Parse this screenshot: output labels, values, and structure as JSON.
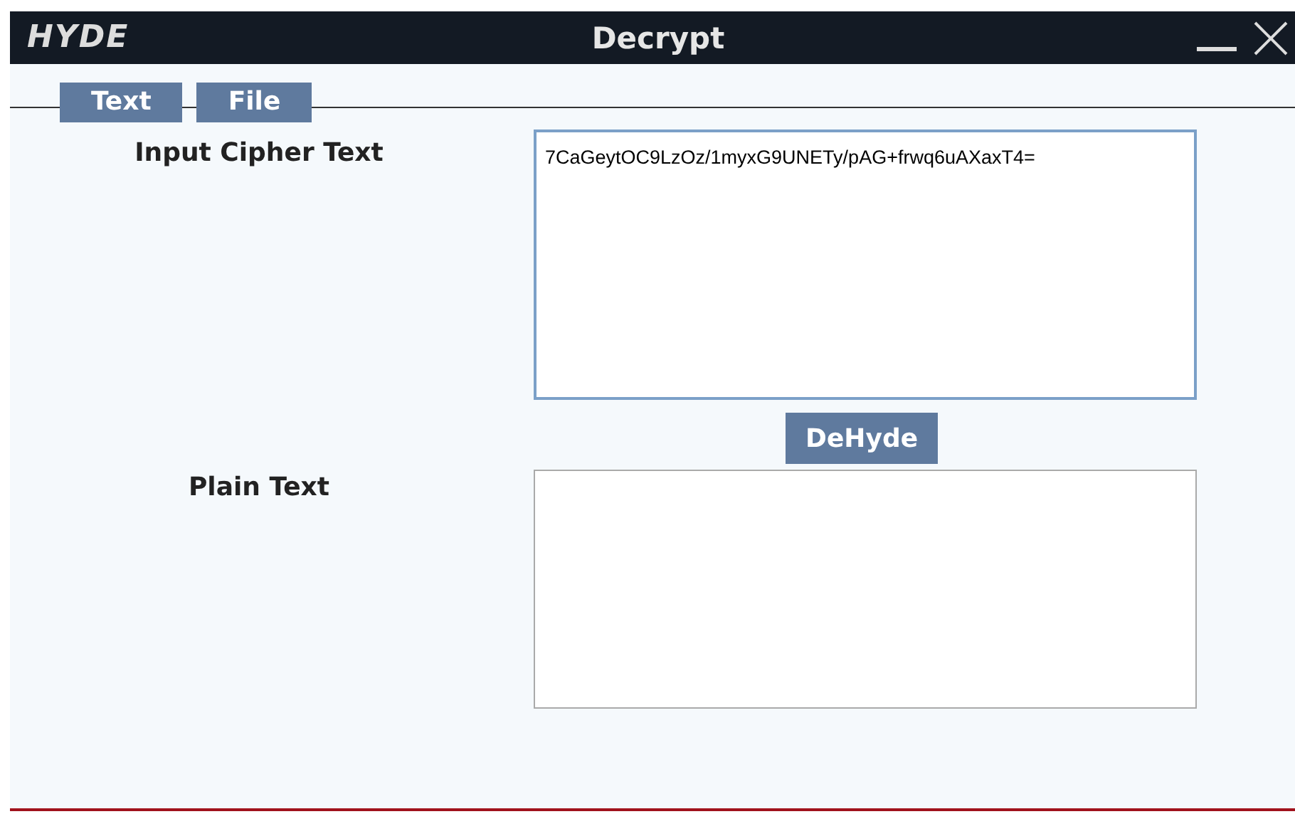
{
  "window": {
    "logo": "HYDE",
    "title": "Decrypt"
  },
  "tabs": [
    {
      "label": "Text"
    },
    {
      "label": "File"
    }
  ],
  "fields": [
    {
      "label": "Input Cipher Text",
      "value": "7CaGeytOC9LzOz/1myxG9UNETy/pAG+frwq6uAXaxT4=",
      "focused": true
    },
    {
      "label": "Plain Text",
      "focused": false
    }
  ],
  "action_button": "DeHyde"
}
